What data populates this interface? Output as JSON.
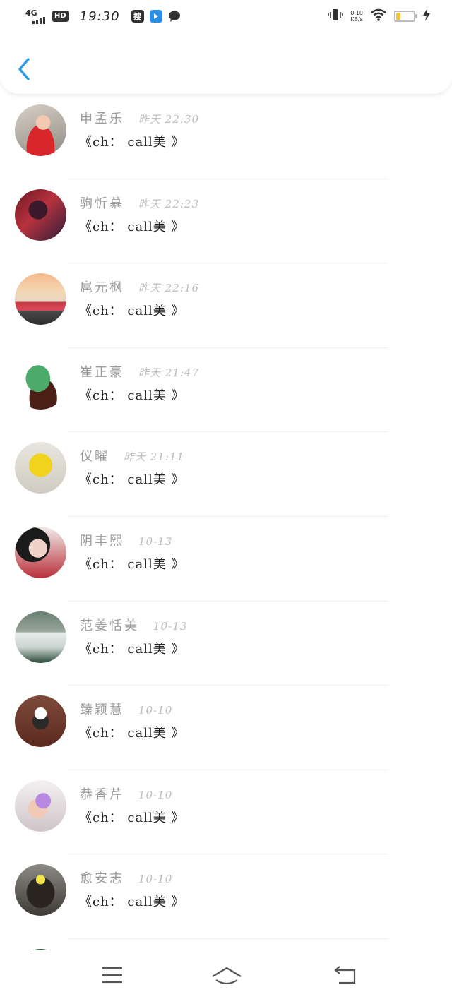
{
  "status_bar": {
    "network": "4G",
    "hd": "HD",
    "time": "19:30",
    "app_sou": "搜",
    "speed_value": "0.10",
    "speed_unit": "KB/s",
    "battery": "23",
    "battery_level": 0.23
  },
  "icons": {
    "back": "chevron-left-icon",
    "menu": "menu-icon",
    "home": "home-icon",
    "return": "back-arrow-icon"
  },
  "colors": {
    "accent": "#2a9be6",
    "name": "#9a9a9a",
    "time": "#bdbdbd",
    "message": "#222222"
  },
  "messages": [
    {
      "name": "申孟乐",
      "time": "昨天 22:30",
      "text": "《ch： call美 》"
    },
    {
      "name": "驹忻慕",
      "time": "昨天 22:23",
      "text": "《ch： call美 》"
    },
    {
      "name": "扈元枫",
      "time": "昨天 22:16",
      "text": "《ch： call美 》"
    },
    {
      "name": "崔正豪",
      "time": "昨天 21:47",
      "text": "《ch： call美 》"
    },
    {
      "name": "仪曜",
      "time": "昨天 21:11",
      "text": "《ch： call美 》"
    },
    {
      "name": "阴丰熙",
      "time": "10-13",
      "text": "《ch： call美 》"
    },
    {
      "name": "范姜恬美",
      "time": "10-13",
      "text": "《ch： call美 》"
    },
    {
      "name": "臻颖慧",
      "time": "10-10",
      "text": "《ch： call美 》"
    },
    {
      "name": "恭香芹",
      "time": "10-10",
      "text": "《ch： call美 》"
    },
    {
      "name": "愈安志",
      "time": "10-10",
      "text": "《ch： call美 》"
    }
  ]
}
